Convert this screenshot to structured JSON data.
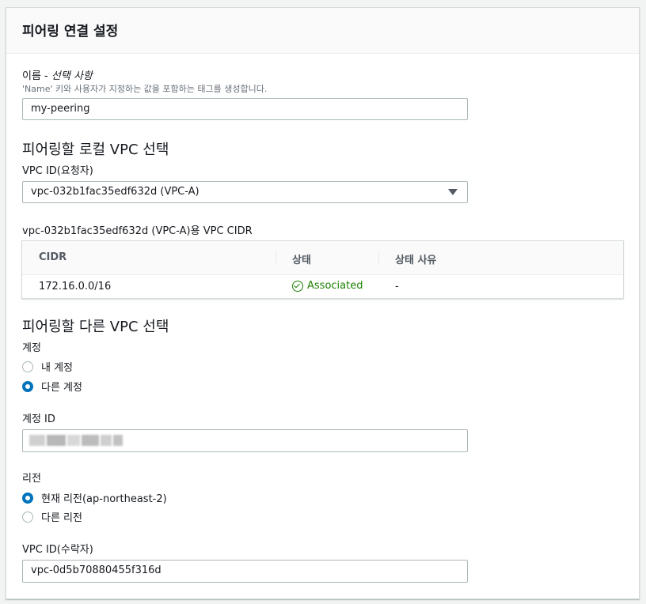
{
  "panel": {
    "title": "피어링 연결 설정"
  },
  "name_field": {
    "label": "이름 - ",
    "label_optional": "선택 사항",
    "hint": "'Name' 키와 사용자가 지정하는 값을 포함하는 태그를 생성합니다.",
    "value": "my-peering"
  },
  "local_vpc": {
    "section_title": "피어링할 로컬 VPC 선택",
    "vpc_id_label": "VPC ID(요청자)",
    "vpc_id_value": "vpc-032b1fac35edf632d (VPC-A)",
    "cidr_caption": "vpc-032b1fac35edf632d (VPC-A)용 VPC CIDR",
    "cidr_table": {
      "headers": [
        "CIDR",
        "상태",
        "상태 사유"
      ],
      "rows": [
        {
          "cidr": "172.16.0.0/16",
          "status": "Associated",
          "reason": "-"
        }
      ]
    }
  },
  "other_vpc": {
    "section_title": "피어링할 다른 VPC 선택",
    "account_label": "계정",
    "account_options": [
      {
        "label": "내 계정",
        "selected": false
      },
      {
        "label": "다른 계정",
        "selected": true
      }
    ],
    "account_id_label": "계정 ID",
    "account_id_value": "",
    "region_label": "리전",
    "region_options": [
      {
        "label": "현재 리전(ap-northeast-2)",
        "selected": true
      },
      {
        "label": "다른 리전",
        "selected": false
      }
    ],
    "accepter_vpc_label": "VPC ID(수락자)",
    "accepter_vpc_value": "vpc-0d5b70880455f316d"
  },
  "colors": {
    "accent": "#0073bb",
    "success": "#1d8102",
    "border": "#aab7b8"
  },
  "icons": {
    "dropdown": "caret-down-icon",
    "status": "check-circle-icon"
  }
}
